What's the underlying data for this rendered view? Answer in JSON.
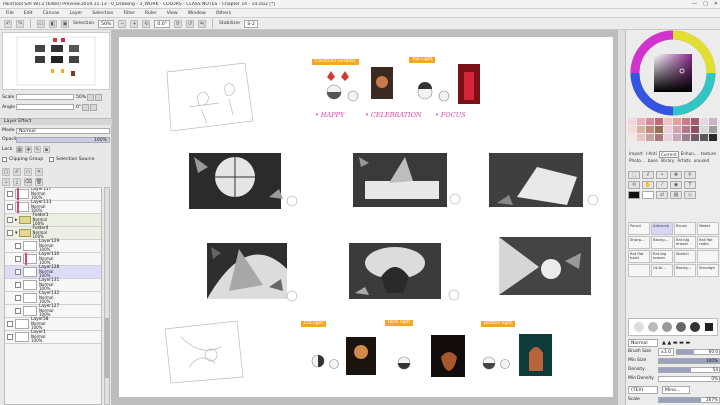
{
  "window": {
    "title": "PaintTool SAI Ver.2 (64bit) Preview.2019.11.13 - 0_Drawing - 3_WORK - COLORS - CLASS NOTES - Chapter 14 - 14.sai2 [*]"
  },
  "menu": [
    "File",
    "Edit",
    "Canvas",
    "Layer",
    "Selection",
    "Filter",
    "Ruler",
    "View",
    "Window",
    "Others"
  ],
  "toolbar": {
    "selection_label": "Selection",
    "zoom_value": "50%",
    "angle_value": "0.0°",
    "stabilizer_label": "Stabilizer",
    "stabilizer_value": "S-2"
  },
  "navigator": {
    "scale_label": "Scale",
    "scale_value": "50%",
    "angle_label": "Angle",
    "angle_value": "0°"
  },
  "layer_props": {
    "effect_header": "Layer Effect",
    "mode_label": "Mode",
    "mode_value": "Normal",
    "opacity_label": "Opacity",
    "opacity_value": "100%",
    "lock_label": "Lock",
    "clipping_label": "Clipping Group",
    "selection_source_label": "Selection Source"
  },
  "layers": [
    {
      "name": "Layer117",
      "mode": "Normal",
      "opacity": "100%",
      "type": "layer",
      "marked": true
    },
    {
      "name": "Layer113",
      "mode": "Normal",
      "opacity": "100%",
      "type": "layer",
      "marked": true
    },
    {
      "name": "Folder1",
      "mode": "Normal",
      "opacity": "100%",
      "type": "folder"
    },
    {
      "name": "Folder4",
      "mode": "Normal",
      "opacity": "100%",
      "type": "folder"
    },
    {
      "name": "Layer129",
      "mode": "Normal",
      "opacity": "100%",
      "type": "layer"
    },
    {
      "name": "Layer130",
      "mode": "Normal",
      "opacity": "100%",
      "type": "layer",
      "marked": true
    },
    {
      "name": "Layer128",
      "mode": "Normal",
      "opacity": "100%",
      "type": "layer",
      "selected": true
    },
    {
      "name": "Layer131",
      "mode": "Normal",
      "opacity": "100%",
      "type": "layer"
    },
    {
      "name": "Layer132",
      "mode": "Normal",
      "opacity": "100%",
      "type": "layer"
    },
    {
      "name": "Layer127",
      "mode": "Normal",
      "opacity": "100%",
      "type": "layer"
    },
    {
      "name": "Layer58",
      "mode": "Normal",
      "opacity": "100%",
      "type": "layer"
    },
    {
      "name": "Layer1",
      "mode": "Normal",
      "opacity": "100%",
      "type": "layer"
    }
  ],
  "canvas": {
    "label_top_left": "Cousteau (visible)",
    "label_top_right": "Top Light",
    "handwritten_1": "• HAPPY",
    "handwritten_2": "• CELEBRATION",
    "handwritten_3": "• FOCUS",
    "label_bottom_1": "Cut light",
    "label_bottom_2": "Rock light",
    "label_bottom_3": "Bottom light"
  },
  "right_panel": {
    "tabs": [
      "Import",
      "I-Anti",
      "Current",
      "Enhan...",
      "texture",
      "Photo...",
      "base",
      "library",
      "Artists",
      "unused"
    ],
    "active_tab": "Current",
    "brushes": [
      {
        "name": "Pencil",
        "sel": false
      },
      {
        "name": "Airbrush",
        "sel": true
      },
      {
        "name": "Brush",
        "sel": false
      },
      {
        "name": "Water",
        "sel": false
      },
      {
        "name": "Sharp...",
        "sel": false
      },
      {
        "name": "Backg...",
        "sel": false
      },
      {
        "name": "flat big eraser",
        "sel": false
      },
      {
        "name": "flat flat radio",
        "sel": false
      },
      {
        "name": "flat flat hard",
        "sel": false
      },
      {
        "name": "flat big eraser",
        "sel": false
      },
      {
        "name": "Sketch",
        "sel": false
      },
      {
        "name": "",
        "sel": false
      },
      {
        "name": "",
        "sel": false
      },
      {
        "name": "Ut-tk...",
        "sel": false
      },
      {
        "name": "Backg...",
        "sel": false
      },
      {
        "name": "Smudge",
        "sel": false
      }
    ],
    "blend_mode": "Normal",
    "brush_size_label": "Brush Size",
    "brush_size_multiplier": "x1.0",
    "brush_size_value": "60.0",
    "min_size_label": "Min Size",
    "min_size_value": "100%",
    "density_label": "Density",
    "density_value": "54",
    "min_density_label": "Min Density",
    "min_density_value": "0%",
    "texture_label": "(TEX)",
    "texture_value": "Mino...",
    "scale_label": "Scale",
    "scale_value": "267%"
  },
  "colors": {
    "accent_label": "#f5a623",
    "handwriting": "#d93f9b"
  }
}
